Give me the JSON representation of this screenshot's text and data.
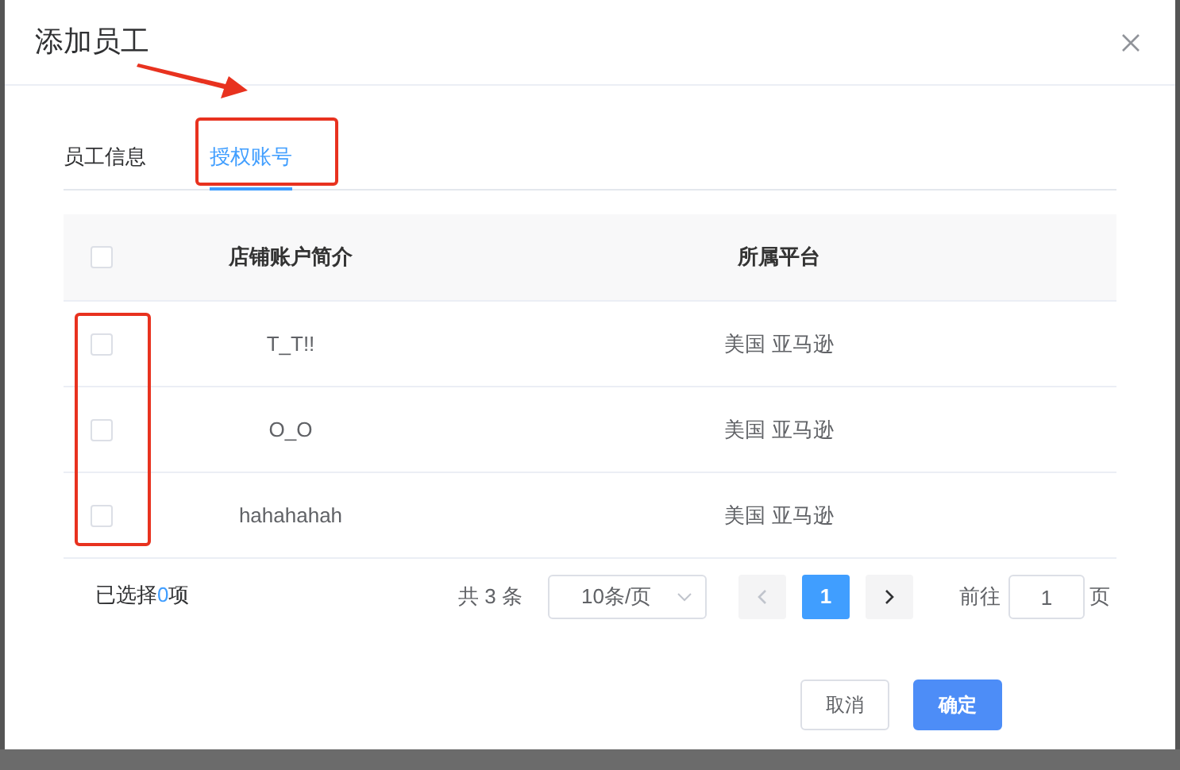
{
  "dialog": {
    "title": "添加员工"
  },
  "tabs": [
    {
      "label": "员工信息",
      "selected": false
    },
    {
      "label": "授权账号",
      "selected": true
    }
  ],
  "table": {
    "select_all": {
      "checked": false
    },
    "columns": [
      "店铺账户简介",
      "所属平台"
    ],
    "rows": [
      {
        "checked": false,
        "cells": [
          "T_T!!",
          "美国 亚马逊"
        ]
      },
      {
        "checked": false,
        "cells": [
          "O_O",
          "美国 亚马逊"
        ]
      },
      {
        "checked": false,
        "cells": [
          "hahahahah",
          "美国 亚马逊"
        ]
      }
    ]
  },
  "selection": {
    "prefix": "已选择",
    "count": "0",
    "suffix": "项"
  },
  "pagination": {
    "total": "共 3 条",
    "page_size": "10条/页",
    "pages": [
      {
        "label": "1",
        "selected": true
      }
    ],
    "goto_label": "前往",
    "goto_value": "1",
    "goto_suffix": "页"
  },
  "buttons": [
    {
      "label": "取消",
      "kind": "secondary"
    },
    {
      "label": "确定",
      "kind": "primary"
    }
  ]
}
